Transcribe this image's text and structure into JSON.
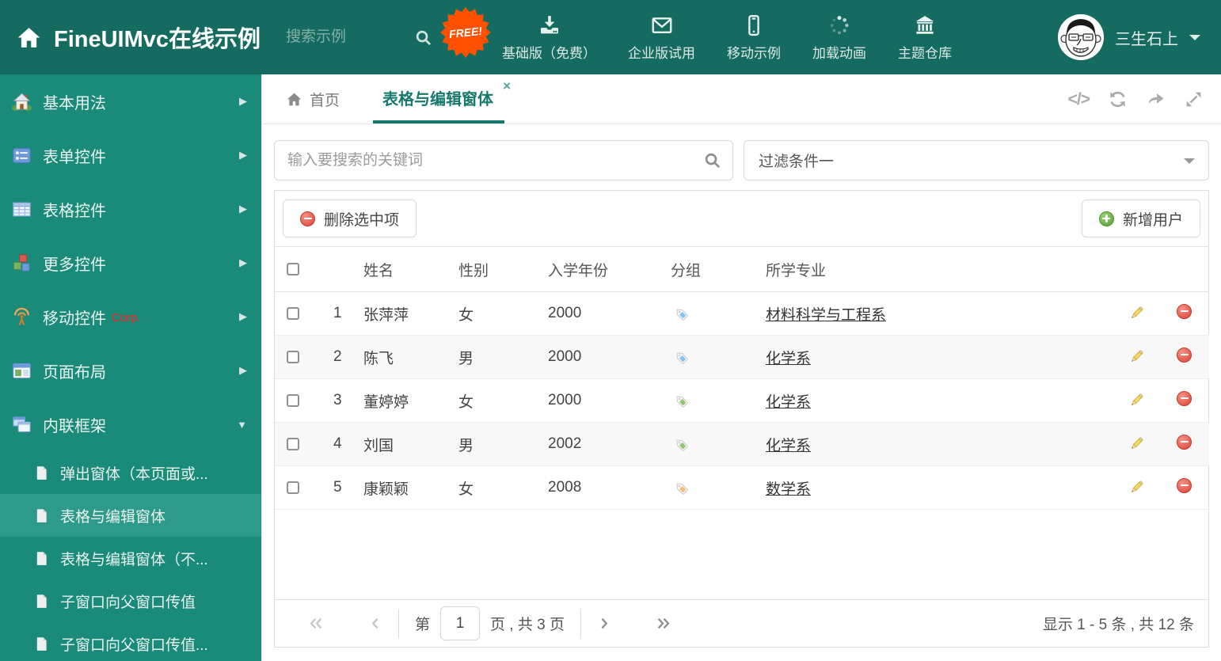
{
  "header": {
    "title": "FineUIMvc在线示例",
    "search_placeholder": "搜索示例",
    "free_badge": "FREE!",
    "nav_items": [
      {
        "icon": "download-icon",
        "label": "基础版（免费）"
      },
      {
        "icon": "envelope-icon",
        "label": "企业版试用"
      },
      {
        "icon": "mobile-icon",
        "label": "移动示例"
      },
      {
        "icon": "spinner-icon",
        "label": "加载动画"
      },
      {
        "icon": "bank-icon",
        "label": "主题仓库"
      }
    ],
    "user_name": "三生石上"
  },
  "sidebar": {
    "items": [
      {
        "icon": "home-color-icon",
        "label": "基本用法",
        "arrow": "right"
      },
      {
        "icon": "form-icon",
        "label": "表单控件",
        "arrow": "right"
      },
      {
        "icon": "grid-icon",
        "label": "表格控件",
        "arrow": "right"
      },
      {
        "icon": "cubes-icon",
        "label": "更多控件",
        "arrow": "right"
      },
      {
        "icon": "antenna-icon",
        "label": "移动控件",
        "badge": "Corp.",
        "arrow": "right"
      },
      {
        "icon": "layout-icon",
        "label": "页面布局",
        "arrow": "right"
      },
      {
        "icon": "frames-icon",
        "label": "内联框架",
        "arrow": "down"
      }
    ],
    "subitems": [
      {
        "label": "弹出窗体（本页面或...",
        "selected": false
      },
      {
        "label": "表格与编辑窗体",
        "selected": true
      },
      {
        "label": "表格与编辑窗体（不...",
        "selected": false
      },
      {
        "label": "子窗口向父窗口传值",
        "selected": false
      },
      {
        "label": "子窗口向父窗口传值...",
        "selected": false
      }
    ]
  },
  "tabbar": {
    "home_tab": "首页",
    "active_tab": "表格与编辑窗体",
    "close_glyph": "×"
  },
  "filter_row": {
    "search_placeholder": "输入要搜索的关键词",
    "filter_selected": "过滤条件一"
  },
  "toolbar": {
    "delete_button": "删除选中项",
    "add_button": "新增用户"
  },
  "table": {
    "columns": {
      "name": "姓名",
      "gender": "性别",
      "year": "入学年份",
      "group": "分组",
      "major": "所学专业"
    },
    "rows": [
      {
        "num": "1",
        "name": "张萍萍",
        "gender": "女",
        "year": "2000",
        "tag_color": "#85C3F2",
        "major": "材料科学与工程系"
      },
      {
        "num": "2",
        "name": "陈飞",
        "gender": "男",
        "year": "2000",
        "tag_color": "#85C3F2",
        "major": "化学系"
      },
      {
        "num": "3",
        "name": "董婷婷",
        "gender": "女",
        "year": "2000",
        "tag_color": "#93C573",
        "major": "化学系"
      },
      {
        "num": "4",
        "name": "刘国",
        "gender": "男",
        "year": "2002",
        "tag_color": "#93C573",
        "major": "化学系"
      },
      {
        "num": "5",
        "name": "康颖颖",
        "gender": "女",
        "year": "2008",
        "tag_color": "#F8BE7E",
        "major": "数学系"
      }
    ]
  },
  "pagination": {
    "prefix": "第",
    "page_value": "1",
    "suffix": "页 , 共 3 页",
    "summary": "显示 1 - 5 条 , 共 12 条"
  },
  "colors": {
    "header_bg": "#166B60",
    "sidebar_bg": "#1A8A79",
    "sidebar_selected_bg": "#2E9A89",
    "accent_teal": "#17796D",
    "free_badge_bg": "#FF5100",
    "corp_text": "#FF1F1F",
    "delete_red": "#DA4433",
    "add_green": "#55A136",
    "pencil_gold": "#F3D960"
  }
}
